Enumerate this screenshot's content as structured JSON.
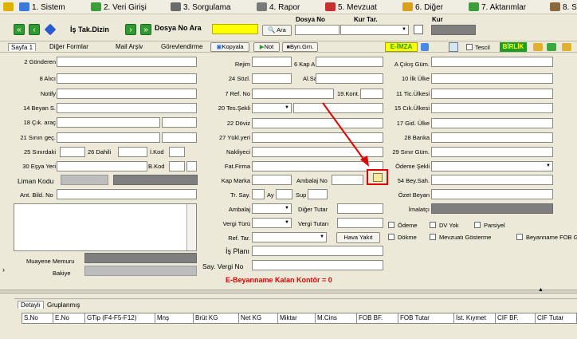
{
  "menu": {
    "items": [
      {
        "label": "1. Sistem",
        "color": "#3a7ad8"
      },
      {
        "label": "2. Veri Girişi",
        "color": "#3b9e3b"
      },
      {
        "label": "3. Sorgulama",
        "color": "#6a6a6a"
      },
      {
        "label": "4. Rapor",
        "color": "#7a7a7a"
      },
      {
        "label": "5. Mevzuat",
        "color": "#c63030"
      },
      {
        "label": "6. Diğer",
        "color": "#d8a020"
      },
      {
        "label": "7. Aktarımlar",
        "color": "#3b9e3b"
      },
      {
        "label": "8. S",
        "color": "#8a6a3a"
      }
    ]
  },
  "toolbar": {
    "is_takip": "İş Tak.Dizin",
    "dosya_no_ara": "Dosya No Ara",
    "ara": "Ara",
    "col_dosya_no": "Dosya No",
    "col_kur_tar": "Kur Tar.",
    "col_kur": "Kur",
    "dosya_value": ""
  },
  "tabs": [
    "Sayfa 1",
    "Diğer Formlar",
    "Mail Arşiv",
    "Görevlendirme",
    "Kopyala",
    "Not",
    "Byn.Grn."
  ],
  "eimza": "E-İMZA",
  "tescil": "Tescil",
  "birlik": "BİRLİK",
  "left_labels": {
    "gonderen": "2 Gönderen",
    "alici": "8 Alıcı",
    "notify": "Notify",
    "beyan_s": "14 Beyan S.",
    "cik_arac": "18 Çık. araç",
    "sinir_gec": "21 Sınırı geç.",
    "sinirdaki": "25 Sınırdaki",
    "dahili": "26 Dahili",
    "i_kod": "İ.Kod",
    "esya_yeri": "30 Eşya Yeri",
    "b_kod": "B.Kod",
    "liman_kodu": "Liman Kodu",
    "ant_bild_no": "Ant. Bild. No",
    "muayene_memuru": "Muayene Memuru",
    "bakiye": "Bakiye"
  },
  "mid_labels": {
    "rejim": "Rejim",
    "kap_a": "6 Kap A",
    "sozl": "24 Sözl.",
    "al_sat": "Al.Sat",
    "ref_no": "7 Ref. No",
    "kont": "19.Kont.",
    "tes_sekli": "20 Tes.Şekli",
    "doviz": "22 Döviz",
    "yuk_yeri": "27 Yükl.yeri",
    "nakliyeci": "Nakliyeci",
    "fat_firma": "Fat.Firma",
    "kap_marka": "Kap Marka",
    "ambalaj_no": "Ambalaj No",
    "tr_say": "Tr. Say.",
    "ay": "Ay",
    "sup": "Sup",
    "ambalaj": "Ambalaj",
    "diger_tutar": "Diğer Tutar",
    "vergi_turu": "Vergi Türü",
    "vergi_tutari": "Vergi Tutarı",
    "ref_tar": "Ref. Tar.",
    "hava_yakit": "Hava Yakıt",
    "is_plani": "İş Planı",
    "say_vergi_no": "Say. Vergi No",
    "kontor": "E-Beyanname Kalan Kontör = 0"
  },
  "right_labels": {
    "cikis_gum": "A Çıkış Güm.",
    "ilk_ulke": "10 İlk Ülke",
    "tic_ulkesi": "11 Tic.Ülkesi",
    "cik_ulkesi": "15 Cık.Ülkesi",
    "gid_ulke": "17 Gid. Ülke",
    "banka": "28 Banka",
    "sinir_gum": "29 Sınır Güm.",
    "odeme_sekli": "Ödeme Şekli",
    "bey_sah": "54 Bey.Sah.",
    "ozet_beyan": "Özet Beyan",
    "imalatci": "İmalatçı",
    "odeme": "Ödeme",
    "dv_yok": "DV Yok",
    "parsiyel": "Parsiyel",
    "dokme": "Dökme",
    "mevzuati": "Mevzuatı Gösterme",
    "beyanname_fob": "Beyanname FOB Gi"
  },
  "bottom_tabs": [
    "Detaylı",
    "Gruplanmış"
  ],
  "grid_columns": [
    "S.No",
    "E.No",
    "GTip (F4-F5-F12)",
    "Mnş",
    "Brüt KG",
    "Net KG",
    "Miktar",
    "M.Cins",
    "FOB BF.",
    "FOB Tutar",
    "İst. Kıymet",
    "CIF BF.",
    "CIF Tutar"
  ],
  "colors": {
    "accent_red": "#e00000",
    "eimza_bg": "#FFFF00",
    "birlik_bg": "#1e9e1e"
  }
}
